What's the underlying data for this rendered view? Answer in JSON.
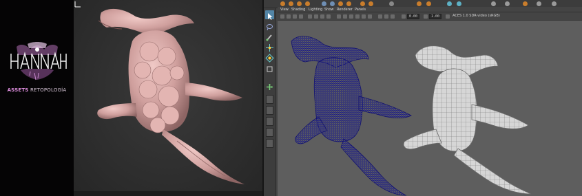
{
  "logo": {
    "name": "HANNAH",
    "caption_part1": "ASSETS",
    "caption_part2": "RETOPOLOGÍA"
  },
  "maya": {
    "panel_menu": [
      "View",
      "Shading",
      "Lighting",
      "Show",
      "Renderer",
      "Panels"
    ],
    "exposure_value": "0.00",
    "gamma_value": "1.00",
    "color_space": "ACES 1.0 SDR-video (sRGB)"
  },
  "colors": {
    "sculpt_clay": "#d3a5a4",
    "wireframe_blue": "#1a1a8c",
    "wireframe_gray": "#bfbfbf",
    "viewport_bg": "#5e5e5e",
    "logo_accent": "#e08fe0",
    "selected_tool": "#5285a6"
  },
  "icons": {
    "select_tool": "arrow-select-icon",
    "lasso_tool": "lasso-icon",
    "paint_tool": "paint-select-icon",
    "move_tool": "move-icon",
    "rotate_tool": "rotate-icon",
    "scale_tool": "scale-icon",
    "last_tool": "last-tool-icon"
  }
}
